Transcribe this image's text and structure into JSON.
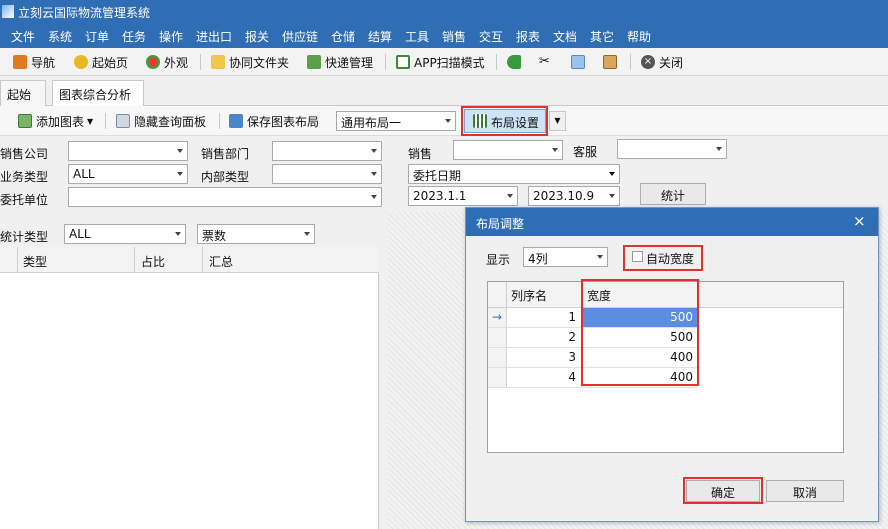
{
  "app": {
    "title": "立刻云国际物流管理系统"
  },
  "menu": [
    "文件",
    "系统",
    "订单",
    "任务",
    "操作",
    "进出口",
    "报关",
    "供应链",
    "仓储",
    "结算",
    "工具",
    "销售",
    "交互",
    "报表",
    "文档",
    "其它",
    "帮助"
  ],
  "toolbar": {
    "nav": "导航",
    "start": "起始页",
    "appearance": "外观",
    "collab": "协同文件夹",
    "express": "快递管理",
    "app_scan": "APP扫描模式",
    "close": "关闭"
  },
  "tabs": [
    "起始页",
    "图表综合分析"
  ],
  "subbar": {
    "add_chart": "添加图表",
    "hide_panel": "隐藏查询面板",
    "save_layout": "保存图表布局",
    "layout_value": "通用布局一",
    "layout_settings": "布局设置"
  },
  "filters": {
    "sales_company": "销售公司",
    "sales_dept": "销售部门",
    "sales": "销售",
    "service": "客服",
    "biz_type": "业务类型",
    "biz_type_value": "ALL",
    "internal_type": "内部类型",
    "date_type_value": "委托日期",
    "client": "委托单位",
    "date_from": "2023.1.1",
    "date_to": "2023.10.9",
    "stat_button": "统计",
    "stat_type": "统计类型",
    "stat_type_value": "ALL",
    "count_value": "票数"
  },
  "grid": {
    "columns": [
      "类型",
      "占比",
      "汇总"
    ]
  },
  "dialog": {
    "title": "布局调整",
    "show_label": "显示",
    "show_value": "4列",
    "auto_width": "自动宽度",
    "col_name": "列序名",
    "col_width": "宽度",
    "rows": [
      {
        "n": "1",
        "w": "500"
      },
      {
        "n": "2",
        "w": "500"
      },
      {
        "n": "3",
        "w": "400"
      },
      {
        "n": "4",
        "w": "400"
      }
    ],
    "ok": "确定",
    "cancel": "取消",
    "close": "×"
  },
  "colors": {
    "titlebar": "#2f6db5",
    "highlight": "#e03030",
    "selected_cell": "#5b8de0"
  }
}
